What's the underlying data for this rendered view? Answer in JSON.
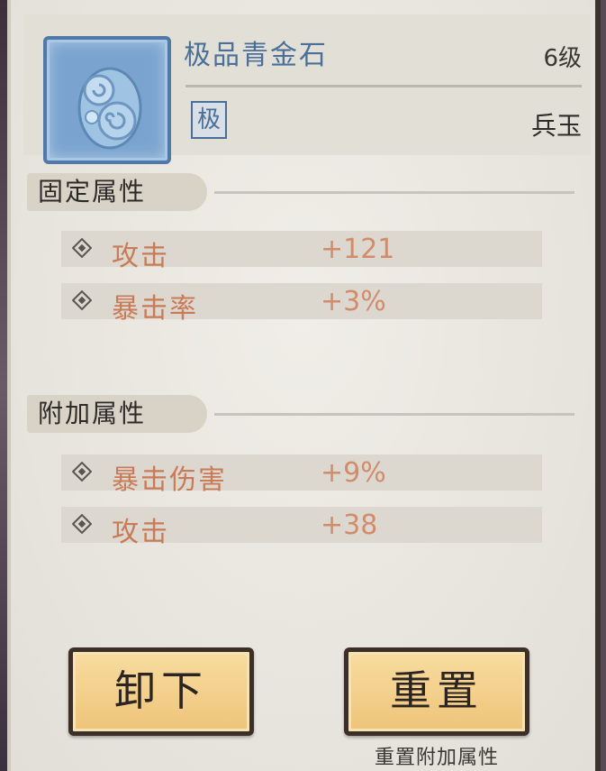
{
  "item": {
    "name": "极品青金石",
    "level": "6级",
    "grade": "极",
    "type": "兵玉",
    "icon": "blue-jade-stone-icon"
  },
  "fixed_section": {
    "title": "固定属性",
    "stats": [
      {
        "name": "攻击",
        "value": "+121"
      },
      {
        "name": "暴击率",
        "value": "+3%"
      }
    ]
  },
  "extra_section": {
    "title": "附加属性",
    "stats": [
      {
        "name": "暴击伤害",
        "value": "+9%"
      },
      {
        "name": "攻击",
        "value": "+38"
      }
    ]
  },
  "buttons": {
    "unequip_label": "卸下",
    "reset_label": "重置",
    "reset_caption": "重置附加属性"
  },
  "colors": {
    "stat_text": "#c97a56",
    "button_fill": "#eec479",
    "name_blue": "#4a6f99"
  }
}
